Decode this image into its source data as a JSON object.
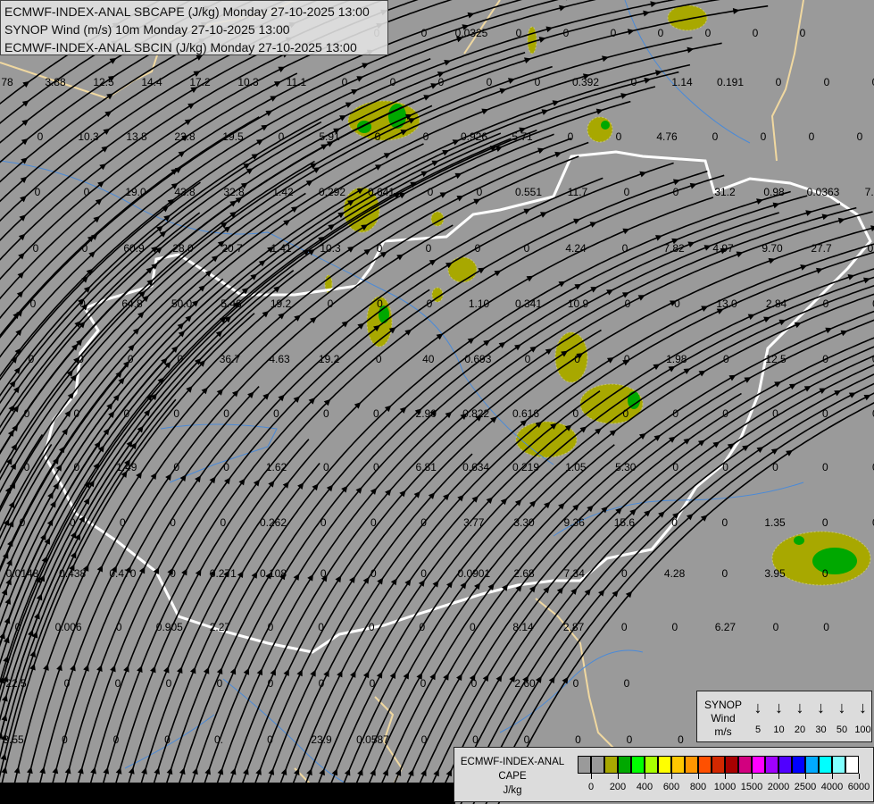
{
  "header": {
    "line1": "ECMWF-INDEX-ANAL SBCAPE (J/kg) Monday 27-10-2025 13:00",
    "line2": "SYNOP Wind (m/s) 10m Monday 27-10-2025 13:00",
    "line3": "ECMWF-INDEX-ANAL SBCIN (J/kg) Monday 27-10-2025 13:00"
  },
  "synop_legend": {
    "title_lines": [
      "SYNOP",
      "Wind",
      "m/s"
    ],
    "arrow_icon": "down-arrow",
    "speeds": [
      "5",
      "10",
      "20",
      "30",
      "50",
      "100"
    ]
  },
  "cape_legend": {
    "title_lines": [
      "ECMWF-INDEX-ANAL",
      "CAPE",
      "J/kg"
    ],
    "colors": [
      "#9a9a9a",
      "#9a9a9a",
      "#a8a800",
      "#00a800",
      "#00ff00",
      "#a8ff00",
      "#ffff00",
      "#ffc800",
      "#ff9600",
      "#ff5000",
      "#d22800",
      "#a80000",
      "#d2007f",
      "#ff00ff",
      "#a000ff",
      "#5000ff",
      "#0000ff",
      "#00aaff",
      "#00ffff",
      "#80ffff",
      "#ffffff"
    ],
    "tick_labels": [
      "0",
      "200",
      "400",
      "600",
      "800",
      "1000",
      "1500",
      "2000",
      "2500",
      "4000",
      "6000"
    ]
  },
  "colors": {
    "background": "#9a9a9a",
    "country_border": "#ffffff",
    "other_border": "#f0d8a0",
    "river": "#4a8ad8",
    "cape_low": "#a8a800",
    "cape_mid": "#00a800",
    "streamline": "#000000"
  },
  "values": [
    [
      "0",
      "0",
      "0.0325",
      "0",
      "0",
      "0",
      "0",
      "0",
      "0",
      "0"
    ],
    [
      "78",
      "3.88",
      "12.5",
      "14.4",
      "17.2",
      "10.3",
      "11.1",
      "0",
      "0",
      "0",
      "0",
      "0",
      "0.392",
      "0",
      "1.14",
      "0.191",
      "0",
      "0",
      "0"
    ],
    [
      "0",
      "10.3",
      "13.8",
      "22.8",
      "19.5",
      "0",
      "5.91",
      "0",
      "0",
      "0.926",
      "5.71",
      "0",
      "0",
      "4.76",
      "0",
      "0",
      "0",
      "0"
    ],
    [
      "0",
      "0",
      "19.0",
      "43.8",
      "32.8",
      "1.42",
      "0.292",
      "0.641",
      "0",
      "0",
      "0.551",
      "11.7",
      "0",
      "0",
      "31.2",
      "0.98",
      "0.0363",
      "7.0"
    ],
    [
      "0",
      "0",
      "60.9",
      "28.0",
      "20.7",
      "1.41",
      "10.3",
      "0",
      "0",
      "0",
      "0",
      "4.24",
      "0",
      "7.82",
      "4.97",
      "9.70",
      "27.7",
      "0"
    ],
    [
      "0",
      "0",
      "64.8",
      "50.0",
      "5.46",
      "19.2",
      "0",
      "0",
      "0",
      "1.10",
      "0.341",
      "10.9",
      "0",
      "0",
      "13.0",
      "2.84",
      "0",
      "0"
    ],
    [
      "0",
      "0",
      "0",
      "0",
      "36.7",
      "4.63",
      "19.2",
      "0",
      "40",
      "0.693",
      "0",
      "0",
      "0",
      "1.98",
      "0",
      "12.5",
      "0",
      "0"
    ],
    [
      "0",
      "0",
      "0",
      "0",
      "0",
      "0",
      "0",
      "0",
      "2.90",
      "0.822",
      "0.616",
      "0",
      "0",
      "0",
      "0",
      "0",
      "0",
      "0"
    ],
    [
      "0",
      "0",
      "1.49",
      "0",
      "0",
      "1.62",
      "0",
      "0",
      "6.81",
      "0.634",
      "0.219",
      "1.05",
      "5.30",
      "0",
      "0",
      "0",
      "0",
      "0"
    ],
    [
      "0",
      "0",
      "0",
      "0",
      "0",
      "0.262",
      "0",
      "0",
      "0",
      "3.77",
      "3.30",
      "9.36",
      "15.6",
      "0",
      "0",
      "1.35",
      "0",
      "0"
    ],
    [
      "0.0148",
      "0.438",
      "0.470",
      "0",
      "0.271",
      "0.108",
      "0",
      "0",
      "0",
      "0.0901",
      "2.68",
      "7.34",
      "0",
      "4.28",
      "0",
      "3.95",
      "0"
    ],
    [
      "0",
      "0.006",
      "0",
      "0.905",
      "2.27",
      "0",
      "0",
      "0",
      "0",
      "0",
      "8.14",
      "2.87",
      "0",
      "0",
      "6.27",
      "0",
      "0"
    ],
    [
      "22.5",
      "0",
      "0",
      "0",
      "0",
      "0",
      "0",
      "0",
      "0",
      "0",
      "2.60",
      "0",
      "0"
    ],
    [
      "3.55",
      "0",
      "0",
      "0",
      "0.",
      "0",
      "23.9",
      "0.0587",
      "0",
      "0",
      "0",
      "0",
      "0",
      "0"
    ]
  ]
}
